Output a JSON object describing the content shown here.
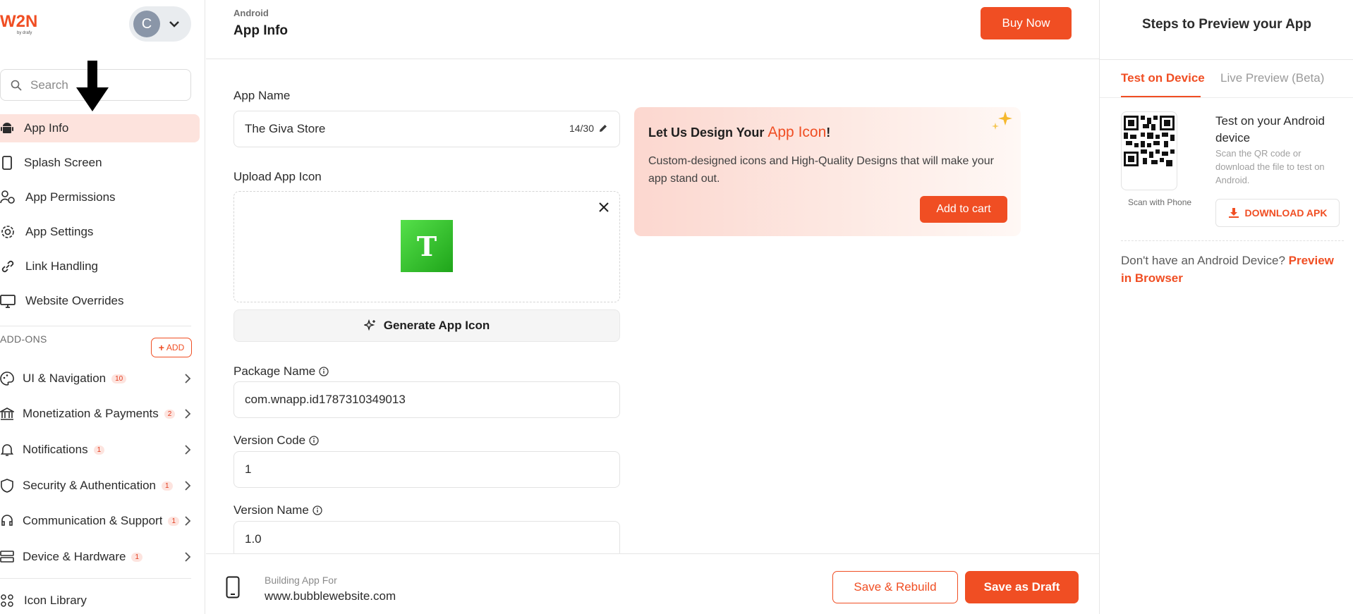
{
  "brand": {
    "logo_text": "W2N",
    "logo_sub": "by drafy"
  },
  "user": {
    "initial": "C"
  },
  "search": {
    "placeholder": "Search"
  },
  "sidebar": {
    "items": [
      {
        "label": "App Info"
      },
      {
        "label": "Splash Screen"
      },
      {
        "label": "App Permissions"
      },
      {
        "label": "App Settings"
      },
      {
        "label": "Link Handling"
      },
      {
        "label": "Website Overrides"
      }
    ],
    "section_label": "ADD-ONS",
    "add_label": "ADD",
    "addons": [
      {
        "label": "UI & Navigation",
        "count": "10"
      },
      {
        "label": "Monetization & Payments",
        "count": "2"
      },
      {
        "label": "Notifications",
        "count": "1"
      },
      {
        "label": "Security & Authentication",
        "count": "1"
      },
      {
        "label": "Communication & Support",
        "count": "1"
      },
      {
        "label": "Device & Hardware",
        "count": "1"
      }
    ],
    "icon_library": "Icon Library"
  },
  "header": {
    "platform": "Android",
    "title": "App Info",
    "buy_now": "Buy Now"
  },
  "form": {
    "app_name_label": "App Name",
    "app_name_value": "The Giva Store",
    "app_name_counter": "14/30",
    "upload_label": "Upload App Icon",
    "icon_letter": "T",
    "generate_label": "Generate App Icon",
    "package_label": "Package Name",
    "package_value": "com.wnapp.id1787310349013",
    "version_code_label": "Version Code",
    "version_code_value": "1",
    "version_name_label": "Version Name",
    "version_name_value": "1.0"
  },
  "promo": {
    "title_start": "Let Us Design Your ",
    "title_highlight": "App Icon",
    "title_end": "!",
    "description": "Custom-designed icons and High-Quality Designs that will make your app stand out.",
    "cta": "Add to cart"
  },
  "bottom": {
    "building_label": "Building App For",
    "website": "www.bubblewebsite.com",
    "save_rebuild": "Save & Rebuild",
    "save_draft": "Save as Draft"
  },
  "preview": {
    "title": "Steps to Preview your App",
    "tabs": [
      {
        "label": "Test on Device"
      },
      {
        "label": "Live Preview (Beta)"
      }
    ],
    "qr_caption": "Scan with Phone",
    "test_heading": "Test on your Android device",
    "test_sub": "Scan the QR code or download the file to test on Android.",
    "download_label": "DOWNLOAD APK",
    "no_device_text": "Don't have an Android Device? ",
    "preview_link": "Preview in Browser"
  },
  "colors": {
    "accent": "#f04e23",
    "active_bg": "#fde3dd"
  }
}
